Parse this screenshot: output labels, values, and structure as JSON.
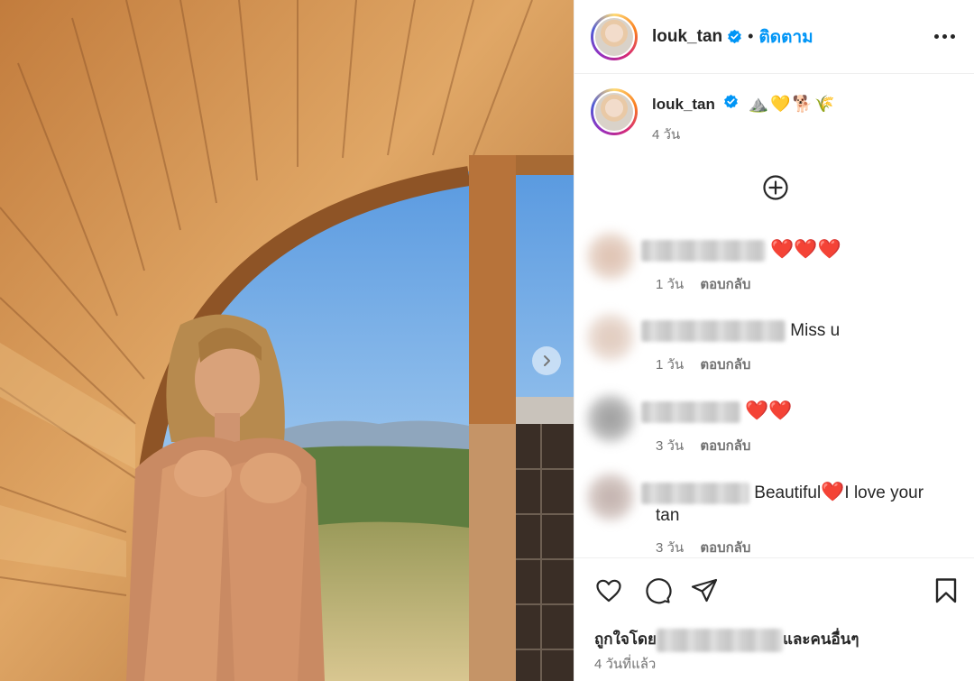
{
  "photo": {
    "alt": "",
    "next_icon": "chevron-right-icon"
  },
  "header": {
    "username": "louk_tan",
    "verified_icon": "verified-badge-icon",
    "separator": "•",
    "follow_label": "ติดตาม",
    "more_icon": "more-options-icon"
  },
  "caption": {
    "username": "louk_tan",
    "text": "⛰️💛🐕🌾",
    "time": "4 วัน"
  },
  "load_more_icon": "plus-circle-icon",
  "comments": [
    {
      "text": "❤️❤️❤️",
      "time": "1 วัน",
      "reply": "ตอบกลับ"
    },
    {
      "text": "Miss u",
      "time": "1 วัน",
      "reply": "ตอบกลับ"
    },
    {
      "text": "❤️❤️",
      "time": "3 วัน",
      "reply": "ตอบกลับ"
    },
    {
      "text_before": "Beautiful",
      "heart": "❤️",
      "text_after": "I love your",
      "text_wrap": "tan",
      "time": "3 วัน",
      "reply": "ตอบกลับ"
    }
  ],
  "actions": {
    "like_icon": "heart-icon",
    "comment_icon": "comment-icon",
    "share_icon": "share-icon",
    "save_icon": "bookmark-icon",
    "likes_prefix": "ถูกใจโดย",
    "likes_suffix": "และคนอื่นๆ",
    "posted_time": "4 วันที่แล้ว"
  },
  "colors": {
    "link": "#0095f6",
    "heart": "#e0112b",
    "secondary_text": "#737373"
  }
}
